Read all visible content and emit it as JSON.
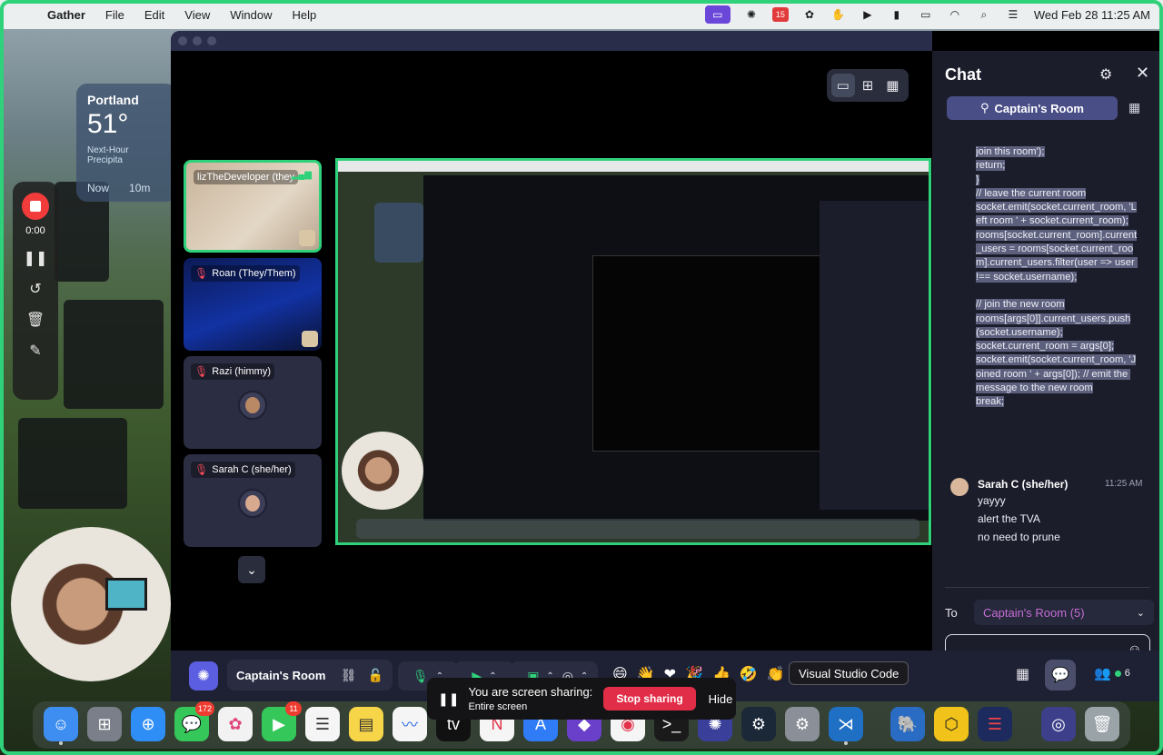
{
  "menubar": {
    "app_name": "Gather",
    "menu_items": [
      "File",
      "Edit",
      "View",
      "Window",
      "Help"
    ],
    "clock": "Wed Feb 28  11:25 AM",
    "calendar_badge": "15"
  },
  "weather": {
    "city": "Portland",
    "temp": "51°",
    "subtitle": "Next-Hour Precipita",
    "times": [
      "Now",
      "10m"
    ]
  },
  "recorder": {
    "time": "0:00"
  },
  "participants": [
    {
      "name": "lizTheDeveloper (they",
      "muted": false,
      "active": true
    },
    {
      "name": "Roan (They/Them)",
      "muted": true,
      "active": false
    },
    {
      "name": "Razi (himmy)",
      "muted": true,
      "active": false
    },
    {
      "name": "Sarah C (she/her)",
      "muted": true,
      "active": false
    }
  ],
  "chat": {
    "title": "Chat",
    "room_pill": "Captain's Room",
    "code_text": "join this room');\nreturn;\n}\n// leave the current room\nsocket.emit(socket.current_room, 'Left room ' + socket.current_room);\nrooms[socket.current_room].current_users = rooms[socket.current_room].current_users.filter(user => user !== socket.username);\n\n// join the new room\nrooms[args[0]].current_users.push(socket.username);\nsocket.current_room = args[0];\nsocket.emit(socket.current_room, 'Joined room ' + args[0]); // emit the message to the new room\nbreak;",
    "message": {
      "author": "Sarah C (she/her)",
      "time": "11:25 AM",
      "lines": [
        "yayyy",
        "alert the TVA",
        "no need to prune"
      ]
    },
    "to_label": "To",
    "to_value": "Captain's Room (5)",
    "input_placeholder": ""
  },
  "bottom_bar": {
    "room_name": "Captain's Room",
    "tooltip": "Visual Studio Code",
    "people_count": "6"
  },
  "share_popup": {
    "title": "You are screen sharing:",
    "subtitle": "Entire screen",
    "stop_label": "Stop sharing",
    "hide_label": "Hide"
  },
  "dock": {
    "messages_badge": "172",
    "facetime_badge": "11"
  },
  "colors": {
    "accent_green": "#2fd27a",
    "gather_purple": "#5b5ee0",
    "stop_red": "#e22d48",
    "chat_bg": "#1c1d2b"
  }
}
